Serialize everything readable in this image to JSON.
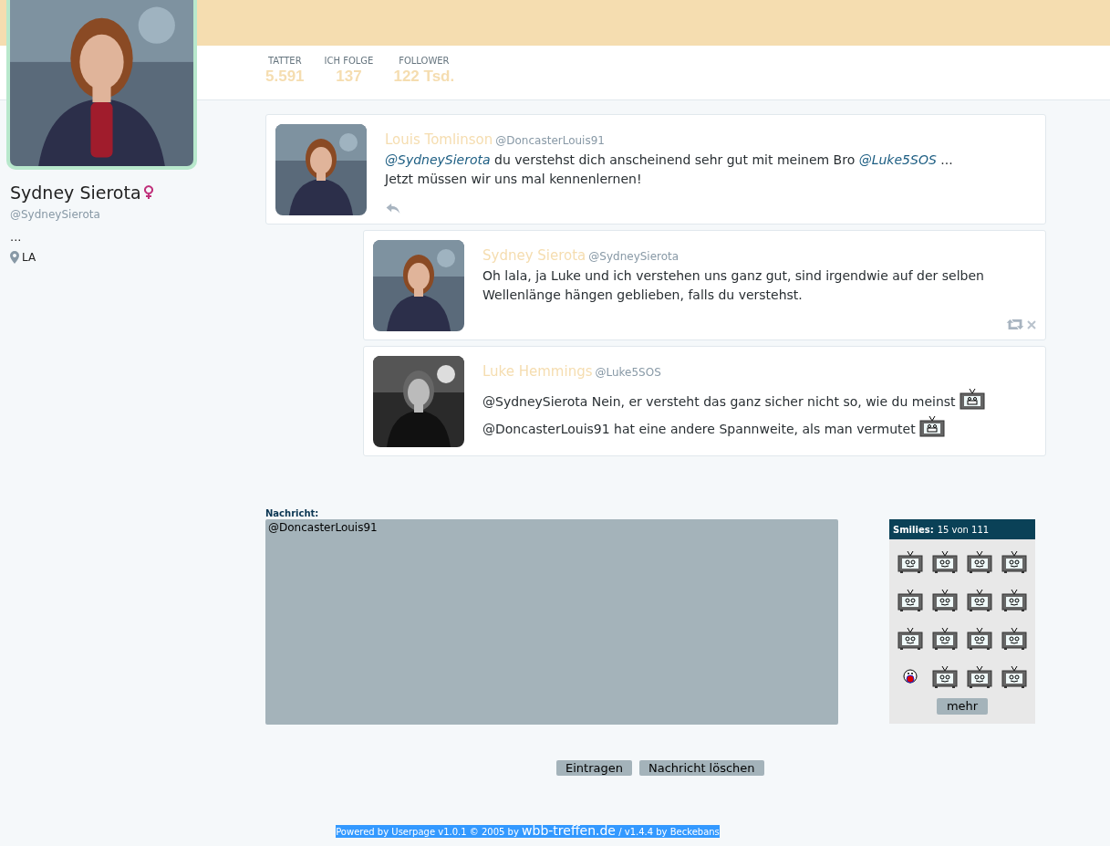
{
  "profile": {
    "name": "Sydney Sierota",
    "handle": "@SydneySierota",
    "bio": "...",
    "location": "LA"
  },
  "stats": [
    {
      "label": "TATTER",
      "value": "5.591"
    },
    {
      "label": "ICH FOLGE",
      "value": "137"
    },
    {
      "label": "FOLLOWER",
      "value": "122 Tsd."
    }
  ],
  "tweets": [
    {
      "indented": false,
      "name": "Louis Tomlinson",
      "handle": "@DoncasterLouis91",
      "lines": [
        [
          {
            "kind": "mention",
            "text": "@SydneySierota"
          },
          {
            "kind": "text",
            "text": " du verstehst dich anscheinend sehr gut mit meinem Bro "
          },
          {
            "kind": "mention",
            "text": "@Luke5SOS"
          },
          {
            "kind": "text",
            "text": " ..."
          }
        ],
        [
          {
            "kind": "text",
            "text": "Jetzt müssen wir uns mal kennenlernen!"
          }
        ]
      ],
      "actions": [
        {
          "kind": "reply"
        }
      ]
    },
    {
      "indented": true,
      "name": "Sydney Sierota",
      "handle": "@SydneySierota",
      "lines": [
        [
          {
            "kind": "text",
            "text": "Oh lala, ja Luke und ich verstehen uns ganz gut, sind irgendwie auf der selben Wellenlänge hängen geblieben, falls du verstehst."
          }
        ]
      ],
      "actions": [
        {
          "kind": "retweet"
        },
        {
          "kind": "delete"
        }
      ]
    },
    {
      "indented": true,
      "name": "Luke Hemmings",
      "handle": "@Luke5SOS",
      "lines": [
        [
          {
            "kind": "text",
            "text": "@SydneySierota Nein, er versteht das ganz sicher nicht so, wie du meinst"
          },
          {
            "kind": "smiley"
          }
        ],
        [
          {
            "kind": "text",
            "text": "@DoncasterLouis91 hat eine andere Spannweite, als man vermutet"
          },
          {
            "kind": "smiley"
          }
        ]
      ]
    }
  ],
  "form": {
    "label": "Nachricht:",
    "value": "@DoncasterLouis91",
    "buttons": [
      "Eintragen",
      "Nachricht löschen"
    ]
  },
  "smilies": {
    "title": "Smilies:",
    "count": "15 von 111",
    "more": "mehr",
    "items": [
      {
        "kind": "tv"
      },
      {
        "kind": "tv"
      },
      {
        "kind": "tv"
      },
      {
        "kind": "tv"
      },
      {
        "kind": "tv"
      },
      {
        "kind": "tv"
      },
      {
        "kind": "tv"
      },
      {
        "kind": "tv"
      },
      {
        "kind": "tv"
      },
      {
        "kind": "tv"
      },
      {
        "kind": "tv"
      },
      {
        "kind": "tv"
      },
      {
        "kind": "face"
      },
      {
        "kind": "tv"
      },
      {
        "kind": "tv"
      },
      {
        "kind": "tv"
      }
    ]
  },
  "footer": {
    "before": "Powered by Userpage v1.0.1 © 2005 by ",
    "link": "wbb-treffen.de",
    "after": " / v1.4.4 by Beckebans"
  }
}
